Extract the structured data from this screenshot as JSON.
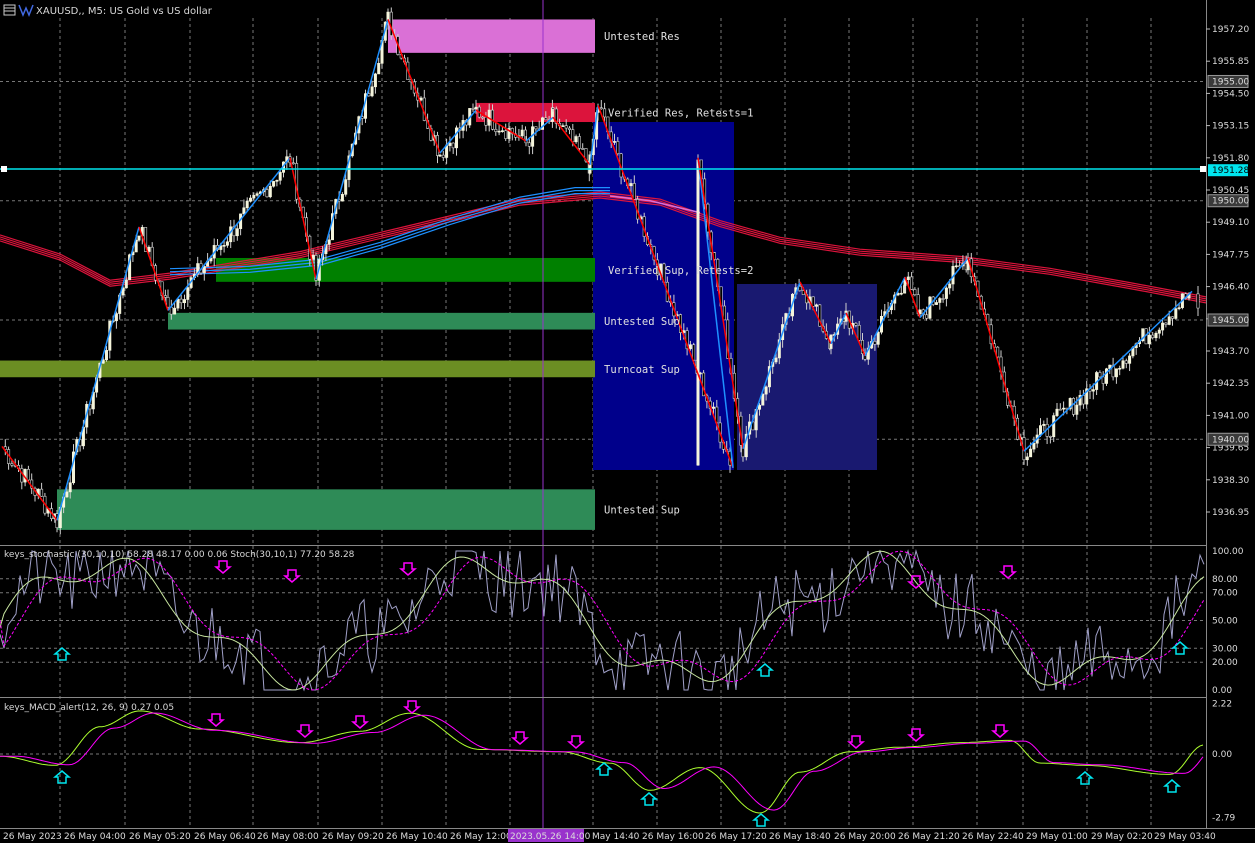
{
  "header": {
    "title": "XAUUSD,, M5:  US Gold vs US dollar"
  },
  "colors": {
    "background": "#000000",
    "up_candle": "#ffffff",
    "down_candle": "#ffffff",
    "zone_untested_res": "#da70d6",
    "zone_verified_res": "#dc143c",
    "zone_verified_sup": "#008000",
    "zone_untested_sup": "#2e8b57",
    "zone_turncoat_sup": "#6b8e23",
    "box_dark_blue": "#00008b",
    "box_navy": "#191970",
    "zigzag_up": "#1e90ff",
    "zigzag_down": "#ff0000",
    "ema_red": "#dc143c",
    "ema_blue": "#1e90ff",
    "hline_cyan": "#00e5ee",
    "period_sep": "#9932cc"
  },
  "zones": [
    {
      "label": "Untested Res",
      "price_top": 1957.6,
      "price_bottom": 1956.2,
      "color": "#da70d6"
    },
    {
      "label": "Verified Res, Retests=1",
      "price_top": 1954.1,
      "price_bottom": 1953.3,
      "color": "#dc143c"
    },
    {
      "label": "Verified Sup, Retests=2",
      "price_top": 1947.6,
      "price_bottom": 1946.6,
      "color": "#008000"
    },
    {
      "label": "Untested Sup",
      "price_top": 1945.3,
      "price_bottom": 1944.6,
      "color": "#2e8b57"
    },
    {
      "label": "Turncoat Sup",
      "price_top": 1943.3,
      "price_bottom": 1942.6,
      "color": "#6b8e23"
    },
    {
      "label": "Untested Sup",
      "price_top": 1937.9,
      "price_bottom": 1936.2,
      "color": "#2e8b57"
    }
  ],
  "main_axis": {
    "price_labels": [
      "1957.20",
      "1955.85",
      "1954.50",
      "1953.15",
      "1951.80",
      "1950.45",
      "1949.10",
      "1947.75",
      "1946.40",
      "1945.05",
      "1943.70",
      "1942.35",
      "1941.00",
      "1939.65",
      "1938.30",
      "1936.95"
    ],
    "price_values": [
      1957.2,
      1955.85,
      1954.5,
      1953.15,
      1951.8,
      1950.45,
      1949.1,
      1947.75,
      1946.4,
      1945.05,
      1943.7,
      1942.35,
      1941.0,
      1939.65,
      1938.3,
      1936.95
    ],
    "boxed_levels": [
      {
        "label": "1955.00",
        "value": 1955.0
      },
      {
        "label": "1950.00",
        "value": 1950.0
      },
      {
        "label": "1945.00",
        "value": 1945.0
      },
      {
        "label": "1940.00",
        "value": 1940.0
      }
    ],
    "current_price_label": "1951.28",
    "current_price": 1951.28,
    "ylim": [
      1935.9,
      1958.15
    ]
  },
  "stoch_panel": {
    "title": "keys_stochastic (30,10,10) 58.28 48.17 0.00 0.06 Stoch(30,10,1) 77.20 58.28",
    "levels": [
      "100.00",
      "80.00",
      "70.00",
      "50.00",
      "30.00",
      "20.00",
      "0.00"
    ],
    "level_values": [
      100,
      80,
      70,
      50,
      30,
      20,
      0
    ],
    "dashed_levels": [
      80,
      70,
      50,
      30,
      20
    ]
  },
  "macd_panel": {
    "title": "keys_MACD_alert(12, 26, 9) 0.27 0.05",
    "levels": [
      "2.22",
      "0.00",
      "-2.79"
    ],
    "level_values": [
      2.22,
      0,
      -2.79
    ]
  },
  "time_axis": {
    "labels": [
      "26 May 2023",
      "26 May 04:00",
      "26 May 05:20",
      "26 May 06:40",
      "26 May 08:00",
      "26 May 09:20",
      "26 May 10:40",
      "26 May 12:00",
      "2023.05.26 14:00",
      "May 14:40",
      "26 May 16:00",
      "26 May 17:20",
      "26 May 18:40",
      "26 May 20:00",
      "26 May 21:20",
      "26 May 22:40",
      "29 May 01:00",
      "29 May 02:20",
      "29 May 03:40"
    ],
    "highlight_label": "2023.05.26 14:00"
  },
  "chart_data": {
    "type": "candlestick",
    "symbol": "XAUUSD,",
    "timeframe": "M5",
    "ylim": [
      1935.9,
      1958.15
    ],
    "zigzag_prices": [
      1939.7,
      1936.6,
      1948.9,
      1945.4,
      1951.8,
      1946.7,
      1957.6,
      1952.0,
      1953.8,
      1952.5,
      1953.5,
      1951.5,
      1954.0,
      1938.8,
      1951.8,
      1939.6,
      1946.6,
      1944.0,
      1945.3,
      1943.5,
      1946.8,
      1945.1,
      1947.6,
      1939.5,
      1946.2
    ]
  }
}
